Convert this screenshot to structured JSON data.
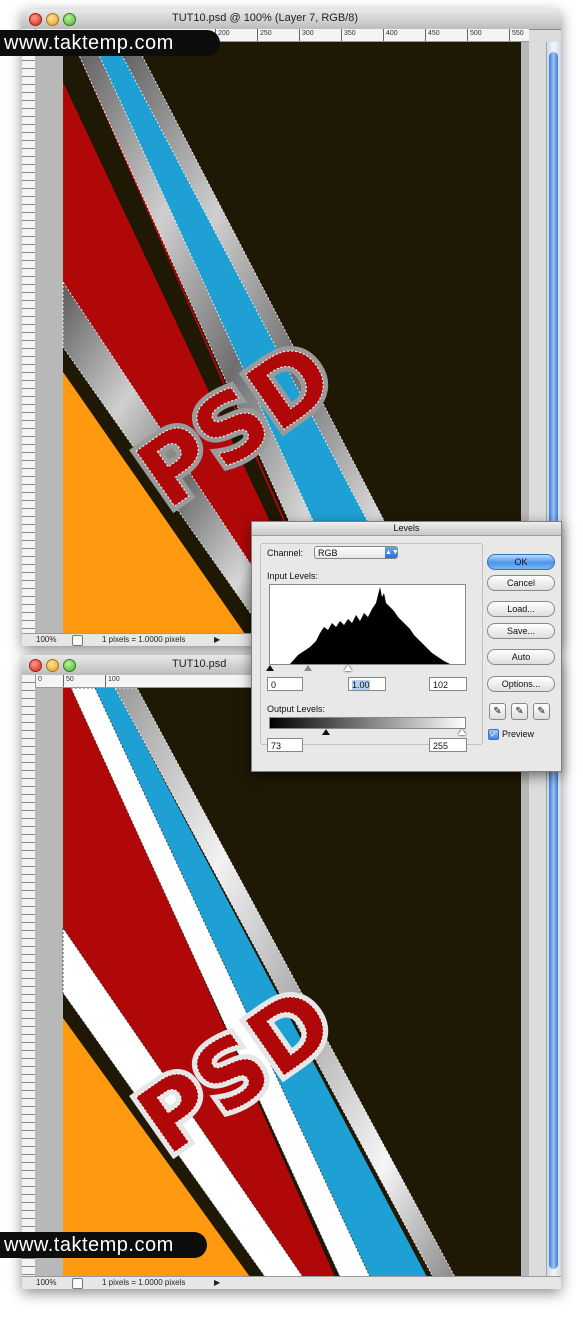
{
  "window_top": {
    "title": "TUT10.psd @ 100% (Layer 7, RGB/8)",
    "ruler_labels": [
      "200",
      "250",
      "300",
      "350",
      "400",
      "450",
      "500",
      "550"
    ],
    "zoom": "100%",
    "status_info": "1 pixels = 1.0000 pixels"
  },
  "window_bottom": {
    "title": "TUT10.psd",
    "ruler_labels": [
      "0",
      "50",
      "100"
    ],
    "zoom": "100%",
    "status_info": "1 pixels = 1.0000 pixels"
  },
  "watermark": "www.taktemp.com",
  "artwork_text": "PSD",
  "levels_dialog": {
    "title": "Levels",
    "channel_label": "Channel:",
    "channel_value": "RGB",
    "input_levels_label": "Input Levels:",
    "input_black": "0",
    "input_gamma": "1.00",
    "input_white": "102",
    "output_levels_label": "Output Levels:",
    "output_black": "73",
    "output_white": "255",
    "buttons": {
      "ok": "OK",
      "cancel": "Cancel",
      "load": "Load...",
      "save": "Save...",
      "auto": "Auto",
      "options": "Options..."
    },
    "preview_label": "Preview",
    "preview_checked": true
  },
  "colors": {
    "background_dark": "#1e1805",
    "stripe_red": "#b00808",
    "stripe_blue": "#1fa0d4",
    "stripe_orange": "#ff9a10",
    "accent_blue": "#3d84dd"
  }
}
